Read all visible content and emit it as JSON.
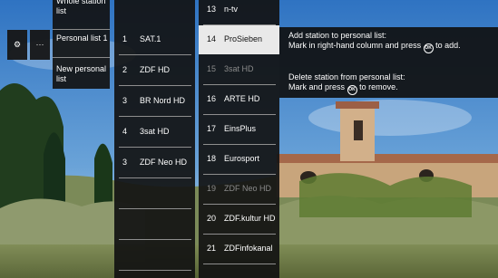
{
  "tools": {
    "gear_label": "⚙",
    "more_label": "···"
  },
  "lists": [
    {
      "label": "Whole station list"
    },
    {
      "label": "Personal list 1"
    },
    {
      "label": "New personal list"
    }
  ],
  "column_a": [
    {
      "num": "1",
      "name": "SAT.1"
    },
    {
      "num": "2",
      "name": "ZDF HD"
    },
    {
      "num": "3",
      "name": "BR Nord HD"
    },
    {
      "num": "4",
      "name": "3sat HD"
    },
    {
      "num": "3",
      "name": "ZDF Neo HD"
    },
    {
      "num": "",
      "name": ""
    },
    {
      "num": "",
      "name": ""
    },
    {
      "num": "",
      "name": ""
    }
  ],
  "column_b": [
    {
      "num": "13",
      "name": "n-tv"
    },
    {
      "num": "14",
      "name": "ProSieben",
      "selected": true
    },
    {
      "num": "15",
      "name": "3sat HD",
      "dim": true
    },
    {
      "num": "16",
      "name": "ARTE HD"
    },
    {
      "num": "17",
      "name": "EinsPlus"
    },
    {
      "num": "18",
      "name": "Eurosport"
    },
    {
      "num": "19",
      "name": "ZDF Neo HD",
      "dim": true
    },
    {
      "num": "20",
      "name": "ZDF.kultur HD"
    },
    {
      "num": "21",
      "name": "ZDFinfokanal"
    }
  ],
  "help": {
    "add_title": "Add station to personal list:",
    "add_body_pre": "Mark in right-hand column and press",
    "add_body_post": "to add.",
    "delete_title": "Delete station from personal list:",
    "delete_body_pre": "Mark and press",
    "delete_body_post": "to remove.",
    "ok_label": "OK"
  },
  "colors": {
    "panel": "#121212",
    "selected": "#e9e9e9",
    "separator": "#8e8e8e"
  }
}
